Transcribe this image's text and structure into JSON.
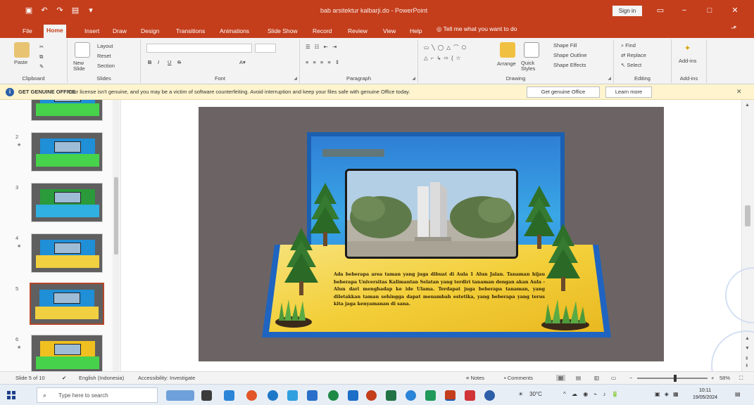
{
  "titlebar": {
    "document_title": "bab arsitektur kalbarji.do - PowerPoint",
    "signin_label": "Sign in",
    "minimize": "−",
    "restore": "□",
    "close": "✕"
  },
  "tabs": [
    "File",
    "Home",
    "Insert",
    "Draw",
    "Design",
    "Transitions",
    "Animations",
    "Slide Show",
    "Record",
    "Review",
    "View",
    "Help"
  ],
  "tell_me": "Tell me what you want to do",
  "ribbon": {
    "clipboard": {
      "paste": "Paste",
      "label": "Clipboard"
    },
    "slides": {
      "new_slide": "New Slide",
      "layout": "Layout",
      "reset": "Reset",
      "section": "Section",
      "label": "Slides"
    },
    "font": {
      "label": "Font",
      "bold": "B",
      "italic": "I",
      "underline": "U",
      "strike": "S"
    },
    "paragraph": {
      "label": "Paragraph"
    },
    "drawing": {
      "arrange": "Arrange",
      "quick_styles": "Quick Styles",
      "shape_fill": "Shape Fill",
      "shape_outline": "Shape Outline",
      "shape_effects": "Shape Effects",
      "label": "Drawing"
    },
    "editing": {
      "find": "Find",
      "replace": "Replace",
      "select": "Select",
      "label": "Editing"
    },
    "addins": {
      "button": "Add-ins",
      "label": "Add-ins"
    }
  },
  "message_bar": {
    "title": "GET GENUINE OFFICE",
    "text": "Your license isn't genuine, and you may be a victim of software counterfeiting. Avoid interruption and keep your files safe with genuine Office today.",
    "primary_button": "Get genuine Office",
    "secondary_button": "Learn more"
  },
  "thumbnails": [
    {
      "num": "",
      "style": "green"
    },
    {
      "num": "2",
      "style": "green"
    },
    {
      "num": "3",
      "style": "green"
    },
    {
      "num": "4",
      "style": "blue"
    },
    {
      "num": "5",
      "style": "blue",
      "selected": true
    },
    {
      "num": "6",
      "style": "gold"
    }
  ],
  "slide": {
    "body_text": "Ada beberapa area taman yang juga dibuat di Aula 1 Alun Jalan. Tanaman hijau beberapa Universitas Kalimantan Selatan yang terdiri tanaman dengan akan Aula - Alun dari menghadap ke ide Ulama. Terdapat juga beberapa tanaman, yang diletakkan taman sehingga dapat menambah estetika, yang beberapa yang terus kita jaga kenyamanan di sana."
  },
  "statusbar": {
    "slide_info": "Slide 5 of 10",
    "language": "English (Indonesia)",
    "accessibility": "Accessibility: Investigate",
    "notes": "Notes",
    "comments": "Comments",
    "zoom": "58%"
  },
  "taskbar": {
    "search_placeholder": "Type here to search",
    "weather": "30°C",
    "time": "10:11",
    "date": "19/05/2024"
  },
  "colors": {
    "accent": "#c43e1c",
    "slide_bg": "#6c6464",
    "board_blue": "#2a7fd0",
    "floor_yellow": "#f3cf3a"
  }
}
